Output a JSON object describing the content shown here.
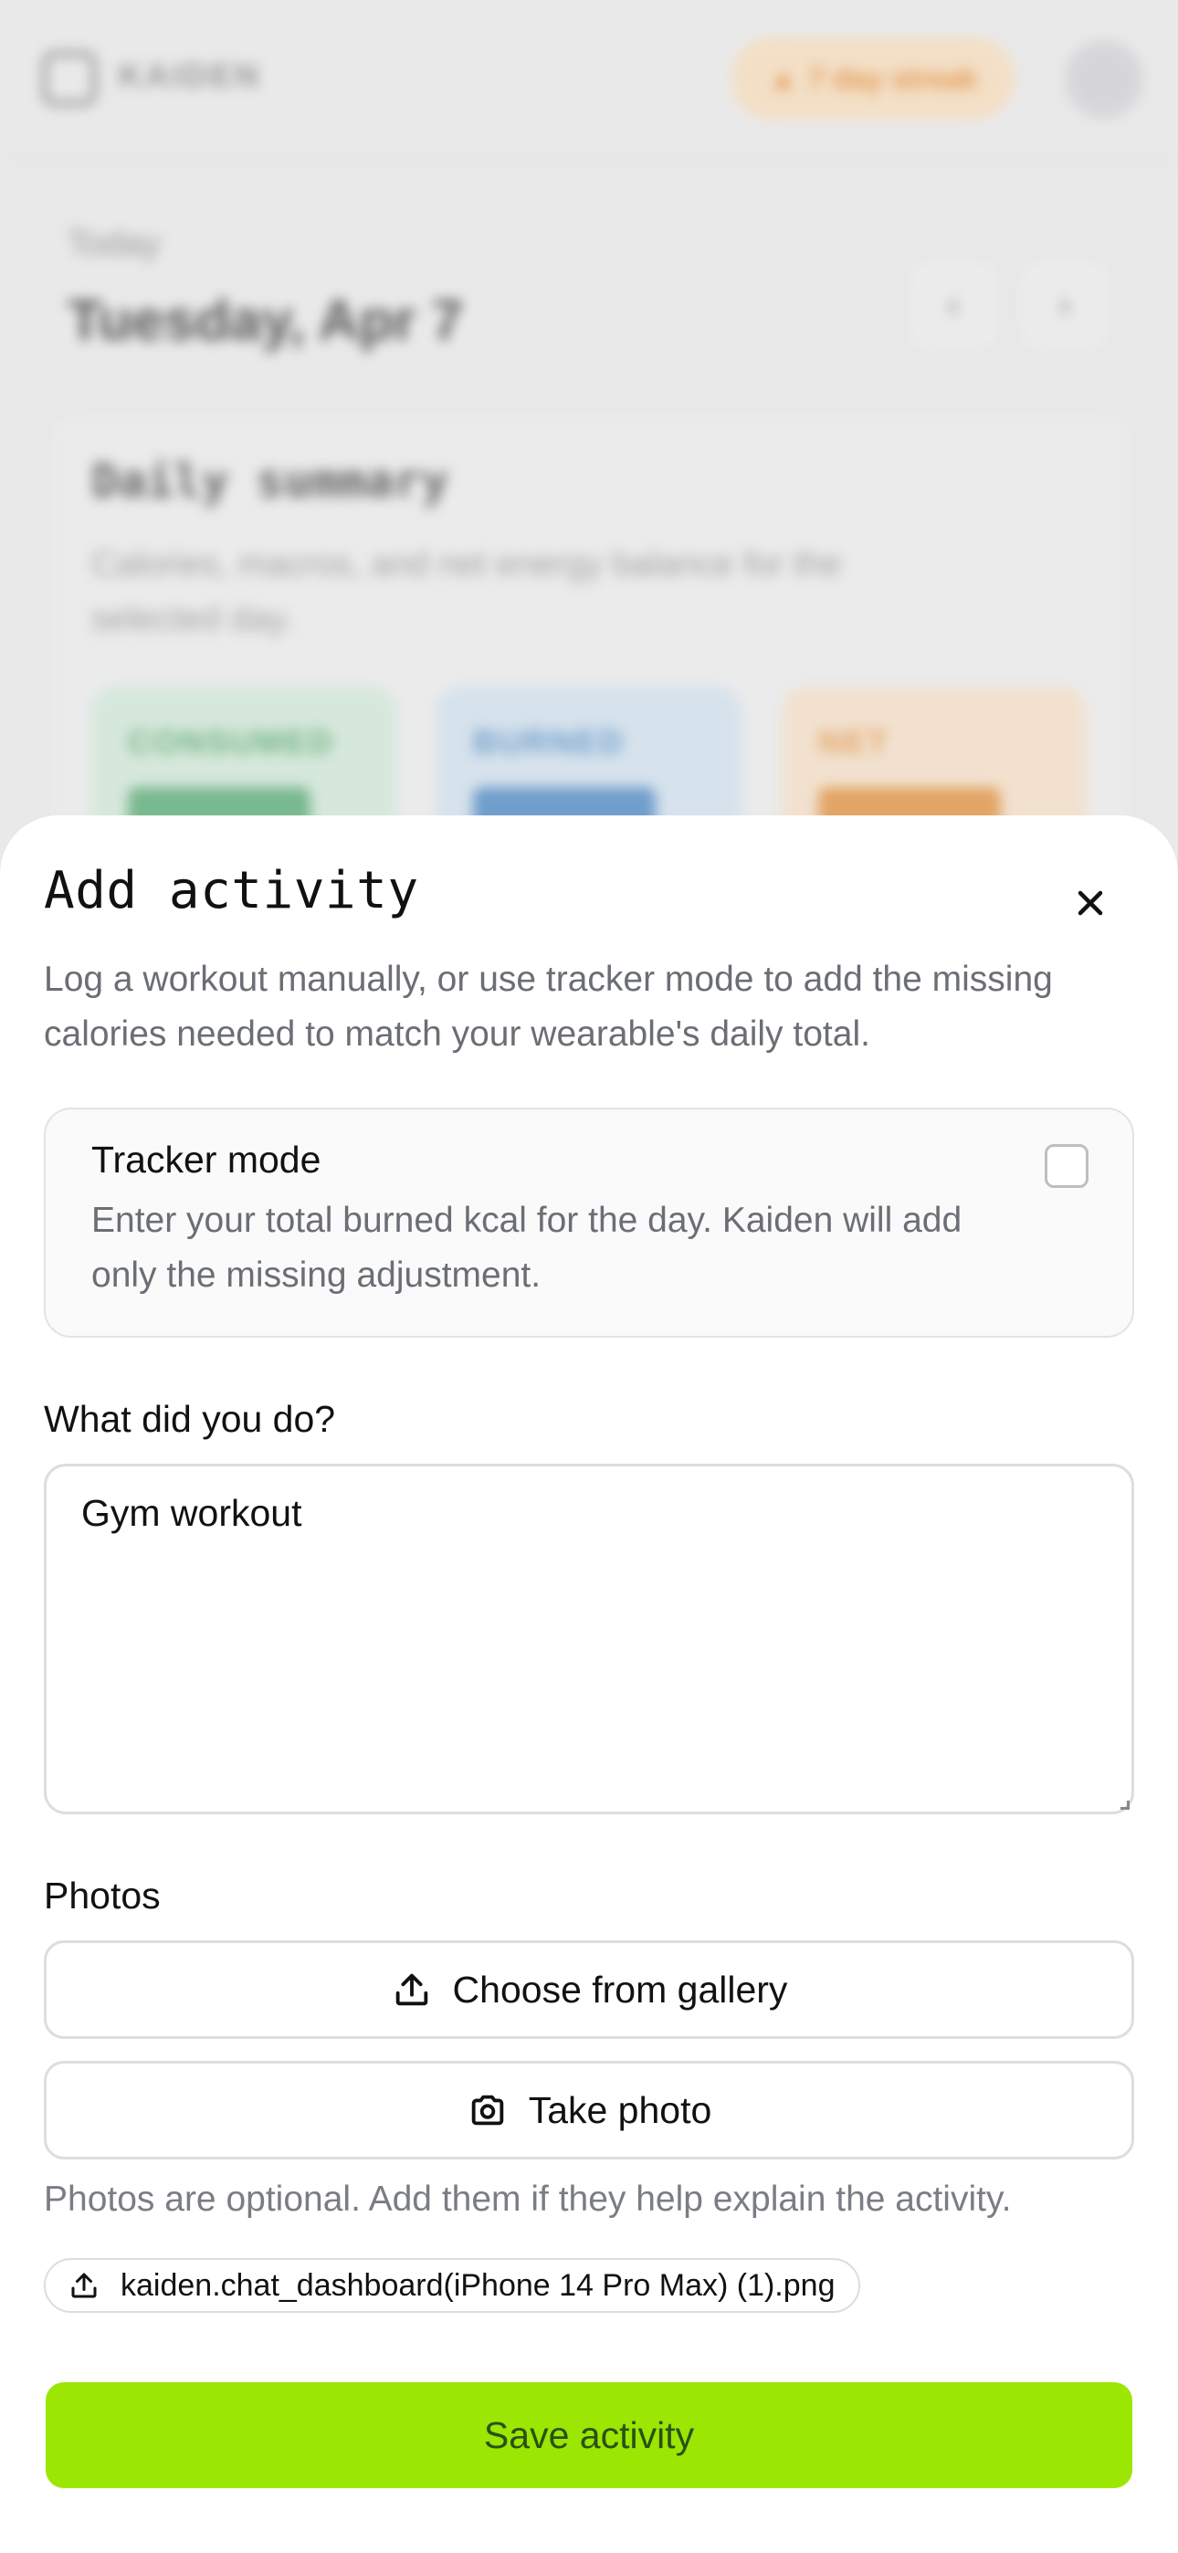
{
  "background": {
    "app_name": "KAIDEN",
    "streak_label": "7 day streak",
    "today_label": "Today",
    "date": "Tuesday, Apr 7",
    "summary_title": "Daily summary",
    "summary_subtitle": "Calories, macros, and net energy balance for the selected day.",
    "tiles": [
      "CONSUMED",
      "BURNED",
      "NET"
    ],
    "colors": {
      "consumed": "#cfe8d6",
      "burned": "#cfe0ee",
      "net": "#f6dfc5"
    }
  },
  "sheet": {
    "title": "Add activity",
    "description": "Log a workout manually, or use tracker mode to add the missing calories needed to match your wearable's daily total.",
    "tracker": {
      "title": "Tracker mode",
      "description": "Enter your total burned kcal for the day. Kaiden will add only the missing adjustment.",
      "checked": false
    },
    "activity_label": "What did you do?",
    "activity_value": "Gym workout",
    "photos_label": "Photos",
    "gallery_button": "Choose from gallery",
    "camera_button": "Take photo",
    "photos_hint": "Photos are optional. Add them if they help explain the activity.",
    "attached_file": "kaiden.chat_dashboard(iPhone 14 Pro Max) (1).png",
    "save_button": "Save activity",
    "colors": {
      "accent": "#9be602",
      "save_text": "#2a5018",
      "muted_text": "#6b6e74"
    }
  }
}
